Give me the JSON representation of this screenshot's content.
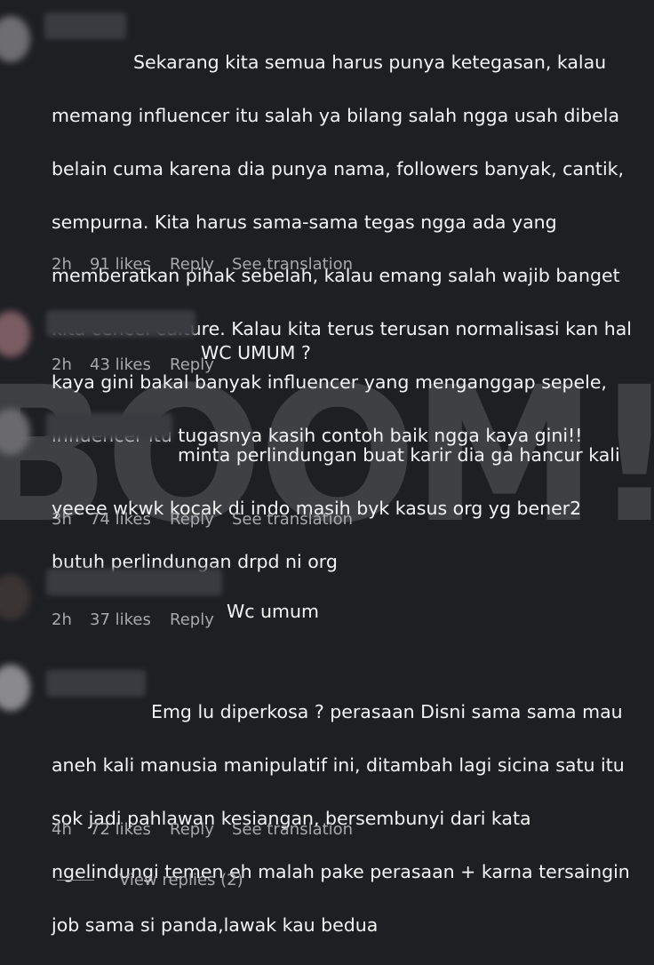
{
  "comments": [
    {
      "text_lines": [
        "Sekarang kita semua harus punya ketegasan, kalau",
        "memang influencer itu salah ya bilang salah ngga usah dibela",
        "belain cuma karena dia punya nama, followers banyak, cantik,",
        "sempurna. Kita harus sama-sama tegas ngga ada yang",
        "memberatkan pihak sebelah, kalau emang salah wajib banget",
        "kita cencel culture. Kalau kita terus terusan normalisasi kan hal",
        "kaya gini bakal banyak influencer yang menganggap sepele,",
        "influencer itu tugasnya kasih contoh baik ngga kaya gini!!"
      ],
      "time": "2h",
      "likes": "91 likes",
      "reply": "Reply",
      "translate": "See translation"
    },
    {
      "text_lines": [
        "WC UMUM ?"
      ],
      "time": "2h",
      "likes": "43 likes",
      "reply": "Reply"
    },
    {
      "text_lines": [
        "minta perlindungan buat karir dia ga hancur kali",
        "yeeee wkwk kocak di indo masih byk kasus org yg bener2",
        "butuh perlindungan drpd ni org"
      ],
      "time": "3h",
      "likes": "74 likes",
      "reply": "Reply",
      "translate": "See translation"
    },
    {
      "text_lines": [
        "Wc umum"
      ],
      "time": "2h",
      "likes": "37 likes",
      "reply": "Reply"
    },
    {
      "text_lines": [
        "Emg lu diperkosa ? perasaan Disni sama sama mau",
        "aneh kali manusia manipulatif ini, ditambah lagi sicina satu itu",
        "sok jadi pahlawan kesiangan, bersembunyi dari kata",
        "ngelindungi temen eh malah pake perasaan + karna tersaingin",
        "job sama si panda,lawak kau bedua"
      ],
      "time": "4h",
      "likes": "72 likes",
      "reply": "Reply",
      "translate": "See translation"
    }
  ],
  "view_replies": "View replies (2)",
  "watermark": "BOOM!",
  "colors": {
    "background": "#1e1f23",
    "text": "#f4f4f4",
    "meta": "#a8a8ad",
    "watermark": "#5a5b60"
  }
}
